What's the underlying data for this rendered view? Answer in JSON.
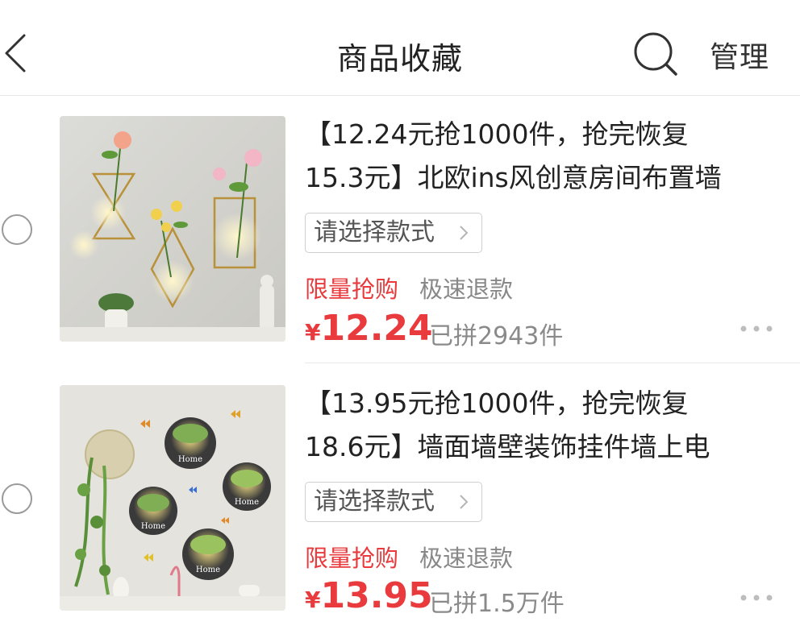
{
  "header": {
    "title": "商品收藏",
    "manage_label": "管理",
    "back_icon": "chevron-left-icon",
    "search_icon": "search-icon"
  },
  "items": [
    {
      "title_line1": "【12.24元抢1000件，抢完恢复",
      "title_line2": "15.3元】北欧ins风创意房间布置墙",
      "style_select_label": "请选择款式",
      "tag_limited": "限量抢购",
      "tag_refund": "极速退款",
      "price_symbol": "¥",
      "price": "12.24",
      "sold": "已拼2943件"
    },
    {
      "title_line1": "【13.95元抢1000件，抢完恢复",
      "title_line2": "18.6元】墙面墙壁装饰挂件墙上电",
      "style_select_label": "请选择款式",
      "tag_limited": "限量抢购",
      "tag_refund": "极速退款",
      "price_symbol": "¥",
      "price": "13.95",
      "sold": "已拼1.5万件",
      "thumb_labels": [
        "Home",
        "Home",
        "Home",
        "Home"
      ]
    }
  ],
  "colors": {
    "accent_red": "#e93b3d",
    "muted_gray": "#888888",
    "divider": "#e8e8e8"
  }
}
